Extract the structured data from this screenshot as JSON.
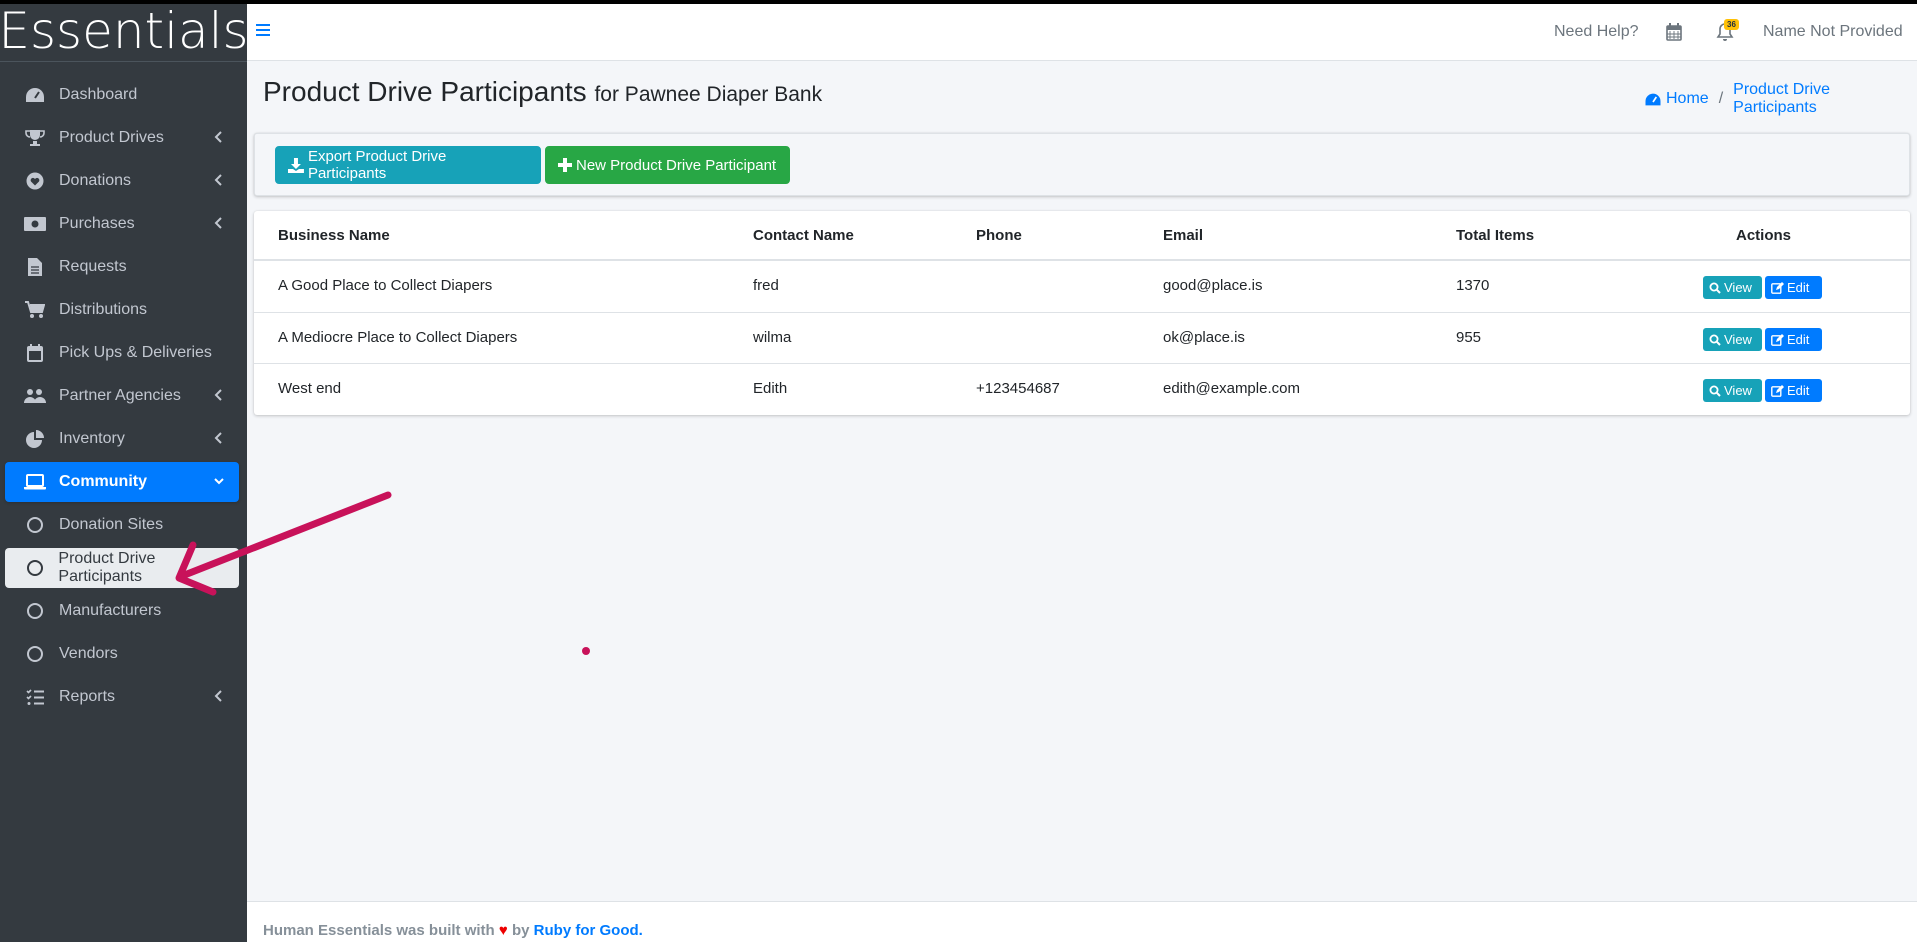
{
  "brand": "Essentials",
  "sidebar": {
    "items": [
      {
        "label": "Dashboard"
      },
      {
        "label": "Product Drives"
      },
      {
        "label": "Donations"
      },
      {
        "label": "Purchases"
      },
      {
        "label": "Requests"
      },
      {
        "label": "Distributions"
      },
      {
        "label": "Pick Ups & Deliveries"
      },
      {
        "label": "Partner Agencies"
      },
      {
        "label": "Inventory"
      },
      {
        "label": "Community"
      },
      {
        "label": "Donation Sites"
      },
      {
        "label": "Product Drive Participants"
      },
      {
        "label": "Manufacturers"
      },
      {
        "label": "Vendors"
      },
      {
        "label": "Reports"
      }
    ]
  },
  "topbar": {
    "help": "Need Help?",
    "badge": "36",
    "user": "Name Not Provided"
  },
  "header": {
    "title": "Product Drive Participants",
    "subtitle": "for Pawnee Diaper Bank",
    "breadcrumb": {
      "home": "Home",
      "current": "Product Drive Participants"
    }
  },
  "actions": {
    "export_label": "Export Product Drive Participants",
    "new_label": "New Product Drive Participant"
  },
  "table": {
    "headers": [
      "Business Name",
      "Contact Name",
      "Phone",
      "Email",
      "Total Items",
      "Actions"
    ],
    "rows": [
      {
        "business": "A Good Place to Collect Diapers",
        "contact": "fred",
        "phone": "",
        "email": "good@place.is",
        "total": "1370"
      },
      {
        "business": "A Mediocre Place to Collect Diapers",
        "contact": "wilma",
        "phone": "",
        "email": "ok@place.is",
        "total": "955"
      },
      {
        "business": "West end",
        "contact": "Edith",
        "phone": "+123454687",
        "email": "edith@example.com",
        "total": ""
      }
    ],
    "view_label": "View",
    "edit_label": "Edit"
  },
  "footer": {
    "prefix": "Human Essentials was built with",
    "heart": "♥",
    "by": "by",
    "link": "Ruby for Good."
  },
  "colors": {
    "sidebar_bg": "#343a40",
    "active": "#007bff",
    "info": "#17a2b8",
    "success": "#28a745",
    "annotation": "#c8125a"
  }
}
